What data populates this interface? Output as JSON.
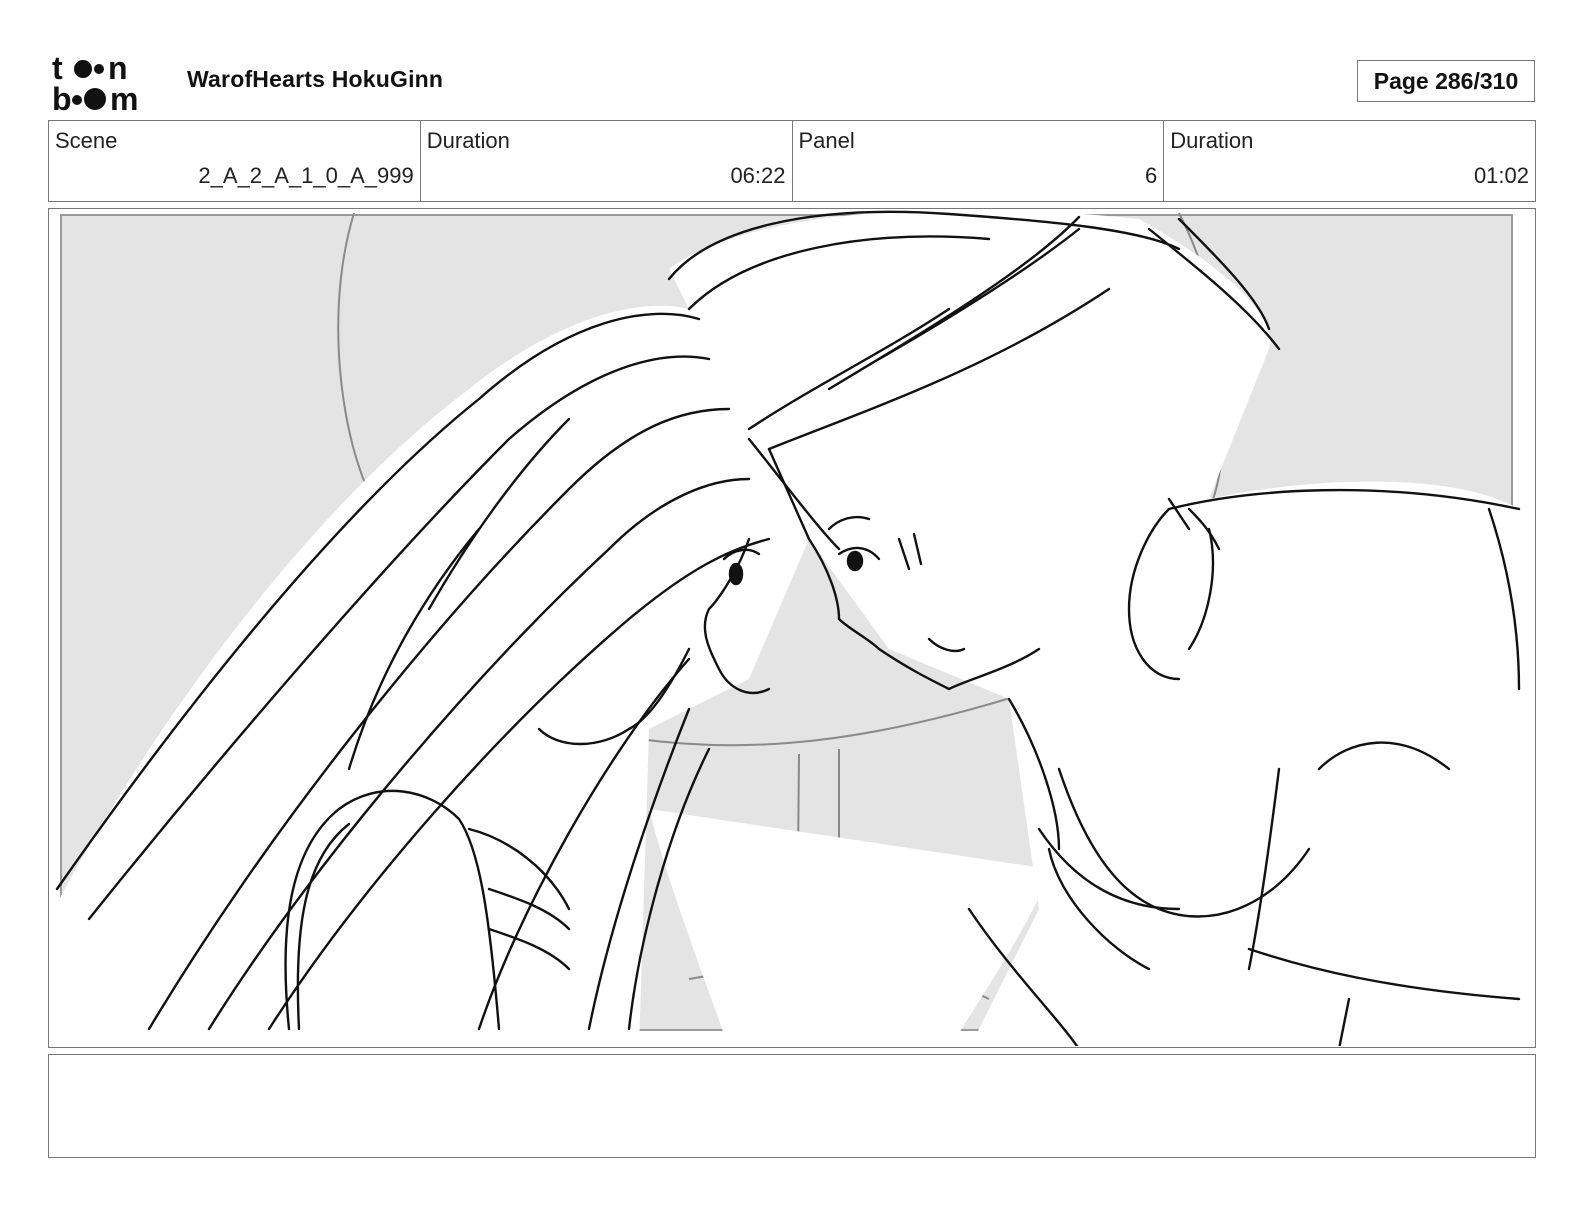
{
  "header": {
    "logo_text": "toon boom",
    "project_title": "WarofHearts HokuGinn",
    "page_label": "Page 286/310"
  },
  "info": {
    "scene_label": "Scene",
    "scene_value": "2_A_2_A_1_0_A_999",
    "scene_duration_label": "Duration",
    "scene_duration_value": "06:22",
    "panel_label": "Panel",
    "panel_value": "6",
    "panel_duration_label": "Duration",
    "panel_duration_value": "01:02"
  },
  "panel": {
    "background_color": "#e4e4e4",
    "line_color": "#111111"
  },
  "notes": {
    "text": ""
  }
}
